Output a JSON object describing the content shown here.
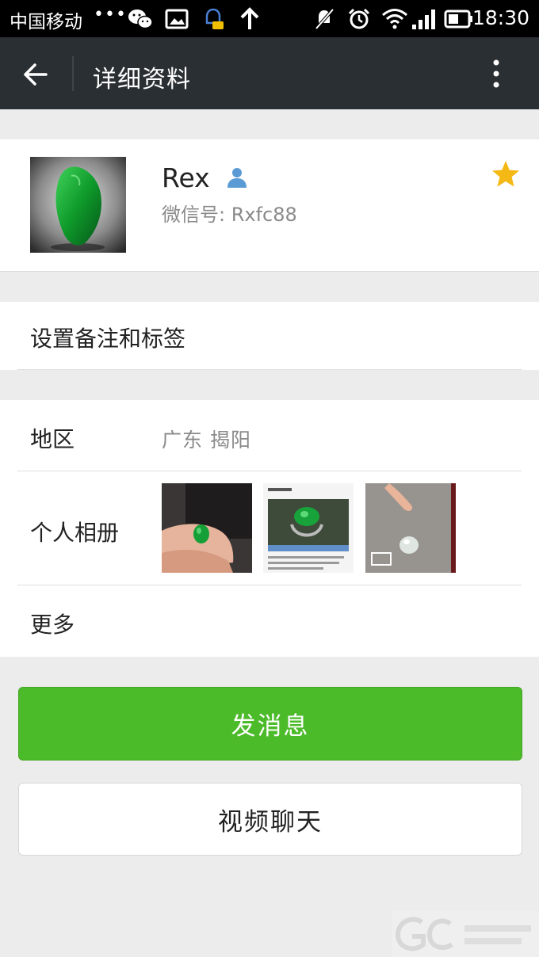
{
  "status_bar": {
    "carrier": "中国移动",
    "dots": "•••",
    "time": "18:30"
  },
  "header": {
    "title": "详细资料"
  },
  "profile": {
    "name": "Rex",
    "wechat_id": "微信号: Rxfc88"
  },
  "remark_row": {
    "label": "设置备注和标签"
  },
  "region_row": {
    "label": "地区",
    "value": "广东  揭阳"
  },
  "album_row": {
    "label": "个人相册"
  },
  "more_row": {
    "label": "更多"
  },
  "buttons": {
    "send": "发消息",
    "video": "视频聊天"
  },
  "colors": {
    "accent_green": "#4cbb2a",
    "header_bg": "#2a2f33",
    "star": "#f5b915",
    "user_icon": "#5b9bd5"
  },
  "icons": [
    "back-arrow-icon",
    "more-vertical-icon",
    "user-icon",
    "star-icon",
    "wechat-icon",
    "image-icon",
    "upload-arrow-icon",
    "mute-icon",
    "alarm-icon",
    "wifi-icon",
    "signal-icon",
    "battery-icon"
  ]
}
